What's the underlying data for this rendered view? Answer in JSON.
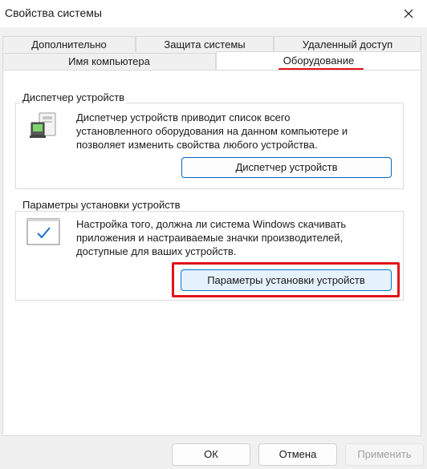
{
  "window": {
    "title": "Свойства системы"
  },
  "tabs": {
    "row1": [
      "Дополнительно",
      "Защита системы",
      "Удаленный доступ"
    ],
    "row2": [
      "Имя компьютера",
      "Оборудование"
    ],
    "active": "Оборудование"
  },
  "device_manager": {
    "group_title": "Диспетчер устройств",
    "desc_lines": [
      "Диспетчер устройств приводит список всего",
      "установленного оборудования на данном компьютере и",
      "позволяет изменить свойства любого устройства."
    ],
    "button_label": "Диспетчер устройств",
    "icon": "device-manager-icon"
  },
  "install_settings": {
    "group_title": "Параметры установки устройств",
    "desc_lines": [
      "Настройка того, должна ли система Windows скачивать",
      "приложения и настраиваемые значки производителей,",
      "доступные для ваших устройств."
    ],
    "button_label": "Параметры установки устройств",
    "icon": "device-install-settings-icon"
  },
  "footer": {
    "ok_label": "ОК",
    "cancel_label": "Отмена",
    "apply_label": "Применить"
  },
  "colors": {
    "highlight_red": "#e0131a",
    "accent_blue": "#0067c0"
  }
}
